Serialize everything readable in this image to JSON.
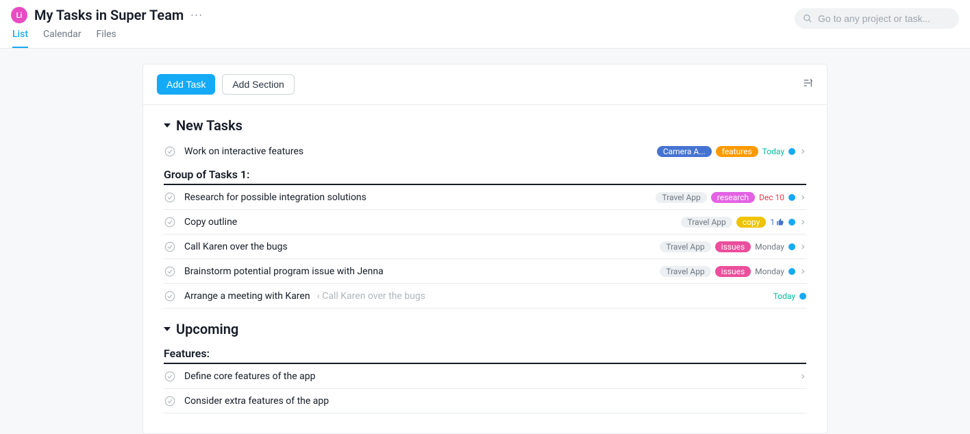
{
  "avatar_text": "Li",
  "page_title": "My Tasks in Super Team",
  "tabs": {
    "list": "List",
    "calendar": "Calendar",
    "files": "Files"
  },
  "search_placeholder": "Go to any project or task...",
  "toolbar": {
    "add_task": "Add Task",
    "add_section": "Add Section"
  },
  "sections": {
    "new_tasks": {
      "title": "New Tasks",
      "tasks": [
        {
          "title": "Work on interactive features",
          "tags": [
            {
              "text": "Camera A...",
              "cls": "blue"
            },
            {
              "text": "features",
              "cls": "orange"
            }
          ],
          "date": "Today",
          "date_cls": "",
          "dot": true
        }
      ],
      "groups": [
        {
          "title": "Group of Tasks 1:",
          "tasks": [
            {
              "title": "Research for possible integration solutions",
              "tags": [
                {
                  "text": "Travel App",
                  "cls": "grey"
                },
                {
                  "text": "research",
                  "cls": "magenta"
                }
              ],
              "date": "Dec 10",
              "date_cls": "red",
              "dot": true
            },
            {
              "title": "Copy outline",
              "tags": [
                {
                  "text": "Travel App",
                  "cls": "grey"
                },
                {
                  "text": "copy",
                  "cls": "yellow"
                }
              ],
              "like": "1",
              "dot": true
            },
            {
              "title": "Call Karen over the bugs",
              "tags": [
                {
                  "text": "Travel App",
                  "cls": "grey"
                },
                {
                  "text": "issues",
                  "cls": "pink"
                }
              ],
              "date": "Monday",
              "date_cls": "grey",
              "dot": true
            },
            {
              "title": "Brainstorm potential program issue with Jenna",
              "tags": [
                {
                  "text": "Travel App",
                  "cls": "grey"
                },
                {
                  "text": "issues",
                  "cls": "pink"
                }
              ],
              "date": "Monday",
              "date_cls": "grey",
              "dot": true
            },
            {
              "title": "Arrange a meeting with Karen",
              "sub": "‹ Call Karen over the bugs",
              "tags": [],
              "date": "Today",
              "date_cls": "",
              "dot": true,
              "no_chevron": true
            }
          ]
        }
      ]
    },
    "upcoming": {
      "title": "Upcoming",
      "groups": [
        {
          "title": "Features:",
          "tasks": [
            {
              "title": "Define core features of the app",
              "tags": [],
              "dot": false
            },
            {
              "title": "Consider extra features of the app",
              "tags": [],
              "dot": false,
              "no_chevron": true
            }
          ]
        }
      ]
    }
  }
}
